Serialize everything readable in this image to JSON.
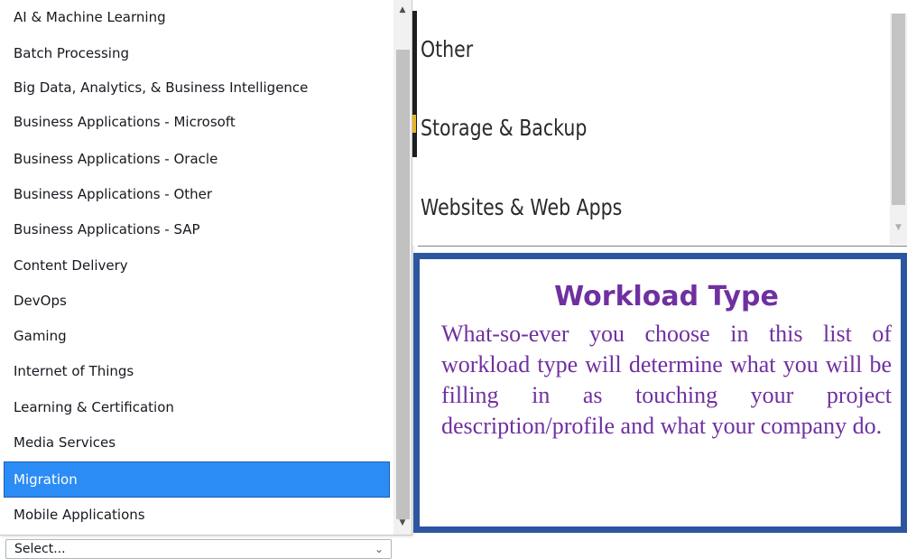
{
  "left_list": {
    "options": [
      {
        "label": "AI & Machine Learning"
      },
      {
        "label": "Batch Processing"
      },
      {
        "label": "Big Data, Analytics, & Business Intelligence"
      },
      {
        "label": "Business Applications - Microsoft"
      },
      {
        "label": "Business Applications - Oracle"
      },
      {
        "label": "Business Applications - Other"
      },
      {
        "label": "Business Applications - SAP"
      },
      {
        "label": "Content Delivery"
      },
      {
        "label": "DevOps"
      },
      {
        "label": "Gaming"
      },
      {
        "label": "Internet of Things"
      },
      {
        "label": "Learning & Certification"
      },
      {
        "label": "Media Services"
      },
      {
        "label": "Migration"
      },
      {
        "label": "Mobile Applications"
      }
    ],
    "selected": "Migration"
  },
  "select": {
    "value": "Select..."
  },
  "right_list": {
    "options": [
      {
        "label": "Other"
      },
      {
        "label": "Storage & Backup"
      },
      {
        "label": "Websites & Web Apps"
      }
    ]
  },
  "info": {
    "title": "Workload Type",
    "body": "What-so-ever you choose in this list of workload type will determine what you will be filling in as touching your project description/profile and what your company do."
  },
  "icons": {
    "scroll_up": "triangle-up-icon",
    "scroll_down": "triangle-down-icon",
    "select_chevron": "chevron-down-icon"
  },
  "colors": {
    "selected_bg": "#2b8cf5",
    "info_border": "#2c56a0",
    "info_text": "#7030a0"
  }
}
